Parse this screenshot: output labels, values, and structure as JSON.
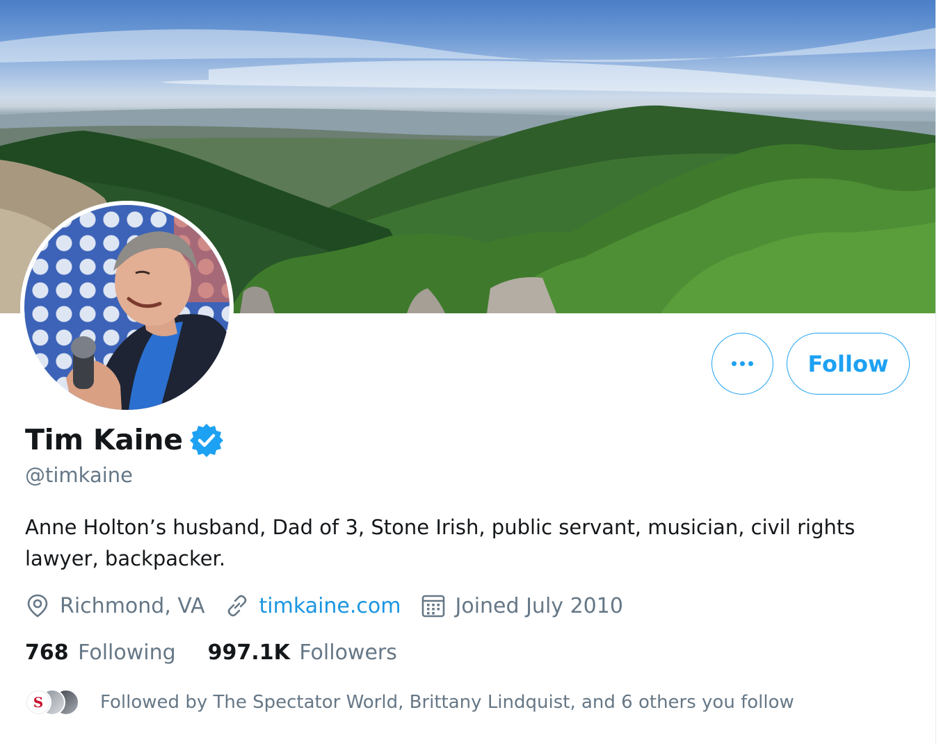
{
  "profile": {
    "name": "Tim Kaine",
    "handle": "@timkaine",
    "bio": "Anne Holton’s husband, Dad of 3, Stone Irish, public servant, musician, civil rights lawyer, backpacker.",
    "verified": true
  },
  "actions": {
    "more_label": "•••",
    "follow_label": "Follow"
  },
  "meta": {
    "location": "Richmond, VA",
    "website": "timkaine.com",
    "joined": "Joined July 2010"
  },
  "stats": {
    "following_count": "768",
    "following_label": "Following",
    "followers_count": "997.1K",
    "followers_label": "Followers"
  },
  "followed_by": {
    "text": "Followed by The Spectator World, Brittany Lindquist, and 6 others you follow",
    "avatar1_letter": "S"
  },
  "colors": {
    "accent": "#1da1f2",
    "link": "#1b95e0",
    "secondary_text": "#657786",
    "primary_text": "#14171a"
  },
  "icons": [
    "location-icon",
    "link-icon",
    "calendar-icon",
    "verified-badge-icon",
    "more-icon"
  ]
}
